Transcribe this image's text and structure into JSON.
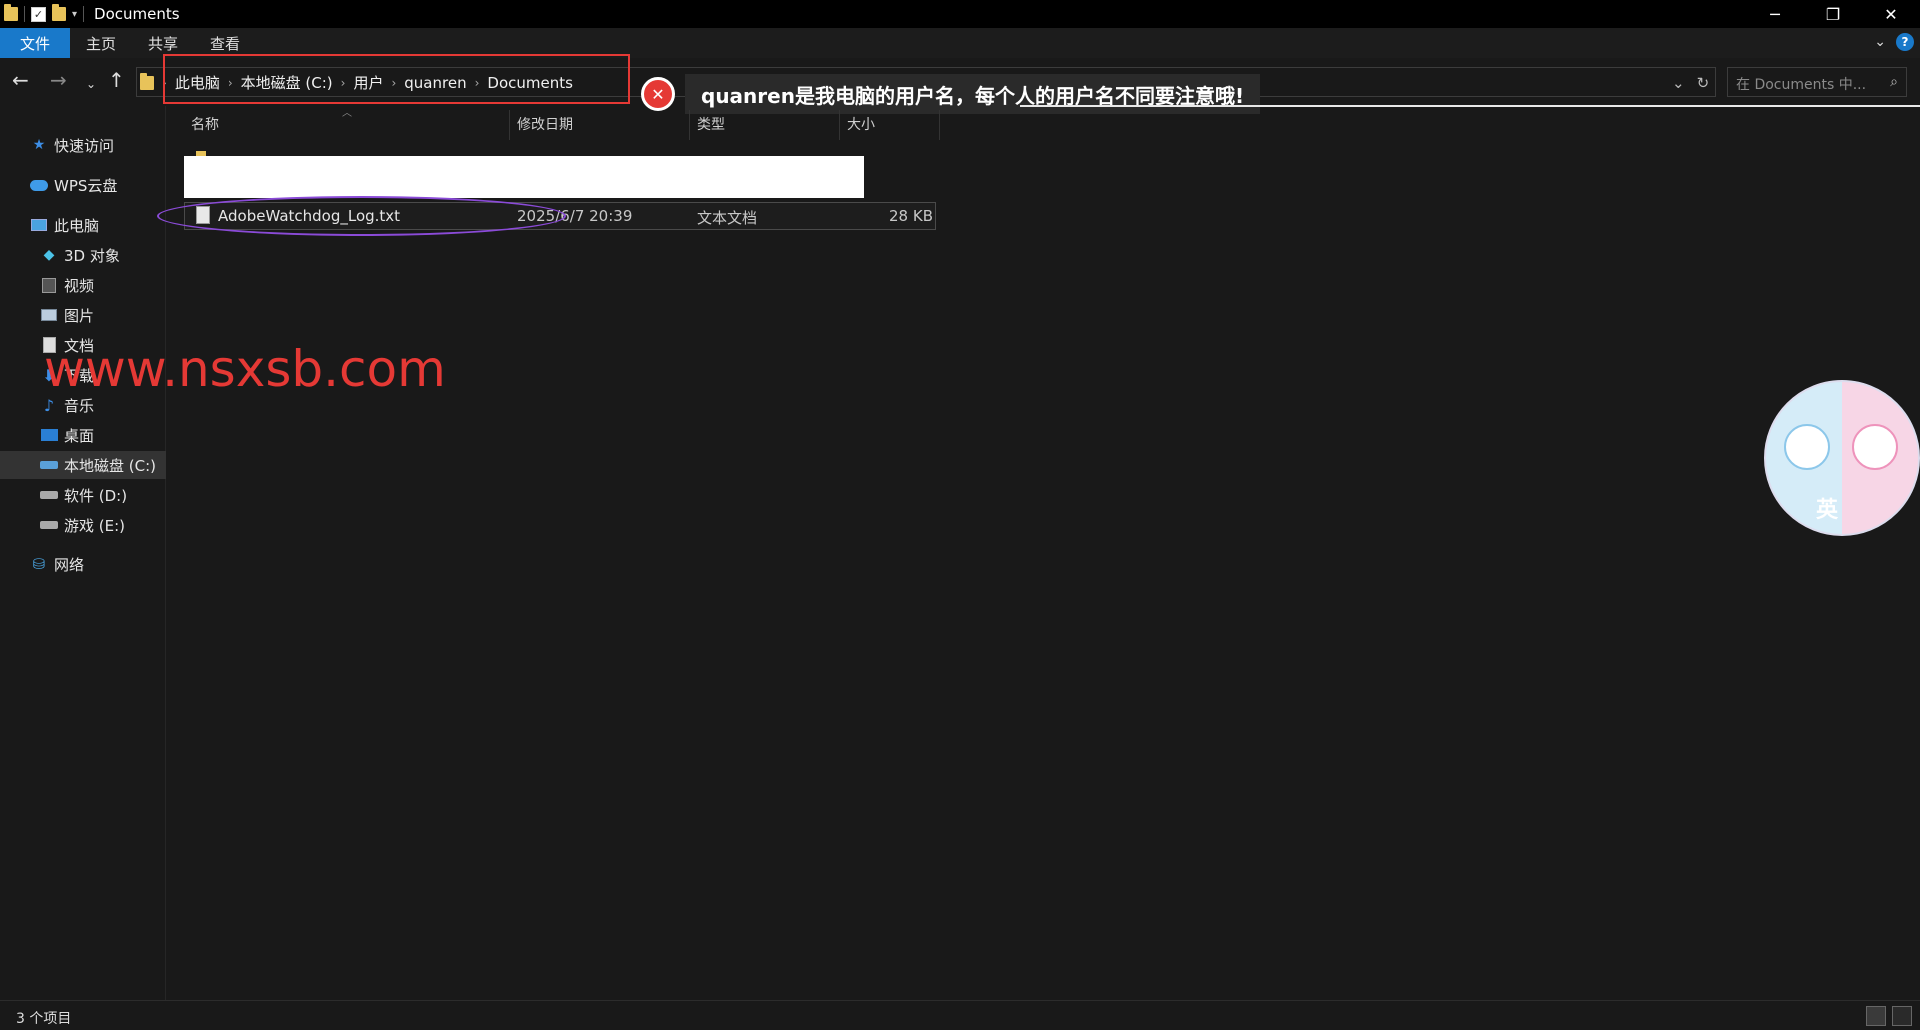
{
  "window": {
    "title": "Documents",
    "controls": [
      "minimize",
      "restore",
      "close"
    ]
  },
  "ribbon": {
    "tabs": [
      "文件",
      "主页",
      "共享",
      "查看"
    ]
  },
  "address": {
    "breadcrumbs": [
      "此电脑",
      "本地磁盘 (C:)",
      "用户",
      "quanren",
      "Documents"
    ],
    "search_placeholder": "在 Documents 中..."
  },
  "annotation": {
    "text": "quanren是我电脑的用户名，每个人的用户名不同要注意哦!"
  },
  "sidebar": {
    "items": [
      {
        "label": "快速访问",
        "icon": "star-icon"
      },
      {
        "label": "WPS云盘",
        "icon": "cloud-icon"
      },
      {
        "label": "此电脑",
        "icon": "pc-icon"
      },
      {
        "label": "3D 对象",
        "icon": "cube-icon"
      },
      {
        "label": "视频",
        "icon": "video-icon"
      },
      {
        "label": "图片",
        "icon": "pictures-icon"
      },
      {
        "label": "文档",
        "icon": "documents-icon"
      },
      {
        "label": "下载",
        "icon": "download-icon"
      },
      {
        "label": "音乐",
        "icon": "music-icon"
      },
      {
        "label": "桌面",
        "icon": "desktop-icon"
      },
      {
        "label": "本地磁盘 (C:)",
        "icon": "drive-icon",
        "selected": true
      },
      {
        "label": "软件 (D:)",
        "icon": "drive-icon"
      },
      {
        "label": "游戏 (E:)",
        "icon": "drive-icon"
      },
      {
        "label": "网络",
        "icon": "network-icon"
      }
    ]
  },
  "watermark": "www.nsxsb.com",
  "table": {
    "columns": [
      "名称",
      "修改日期",
      "类型",
      "大小"
    ],
    "rows": [
      {
        "name": "AdobeWatchdog_Log.txt",
        "modified": "2025/6/7 20:39",
        "type": "文本文档",
        "size": "28 KB"
      }
    ]
  },
  "sticker": {
    "char": "英"
  },
  "status": {
    "count": "3 个项目"
  },
  "colors": {
    "accent": "#1979ca",
    "annotation_red": "#e53935",
    "highlight_purple": "#8b4bd8"
  }
}
